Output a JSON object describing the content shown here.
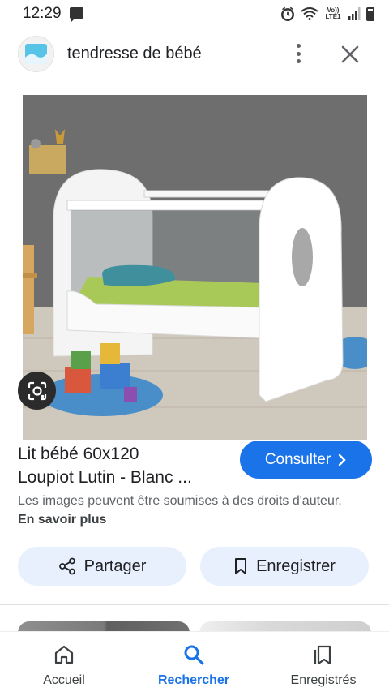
{
  "status_bar": {
    "time": "12:29",
    "network_label": "Vo)) LTE1"
  },
  "header": {
    "site_name": "tendresse de bébé",
    "logo_color": "#57c3e6"
  },
  "image": {
    "description_icon": "crib-photo"
  },
  "product": {
    "title_line1": "Lit bébé 60x120",
    "title_line2": "Loupiot Lutin - Blanc ...",
    "consult_label": "Consulter",
    "copyright_text": "Les images peuvent être soumises à des droits d'auteur.",
    "learn_more": "En savoir plus"
  },
  "actions": {
    "share_label": "Partager",
    "save_label": "Enregistrer"
  },
  "nav": {
    "home_label": "Accueil",
    "search_label": "Rechercher",
    "saved_label": "Enregistrés"
  },
  "colors": {
    "accent": "#1a73e8",
    "chip_bg": "#e8f0fe"
  }
}
